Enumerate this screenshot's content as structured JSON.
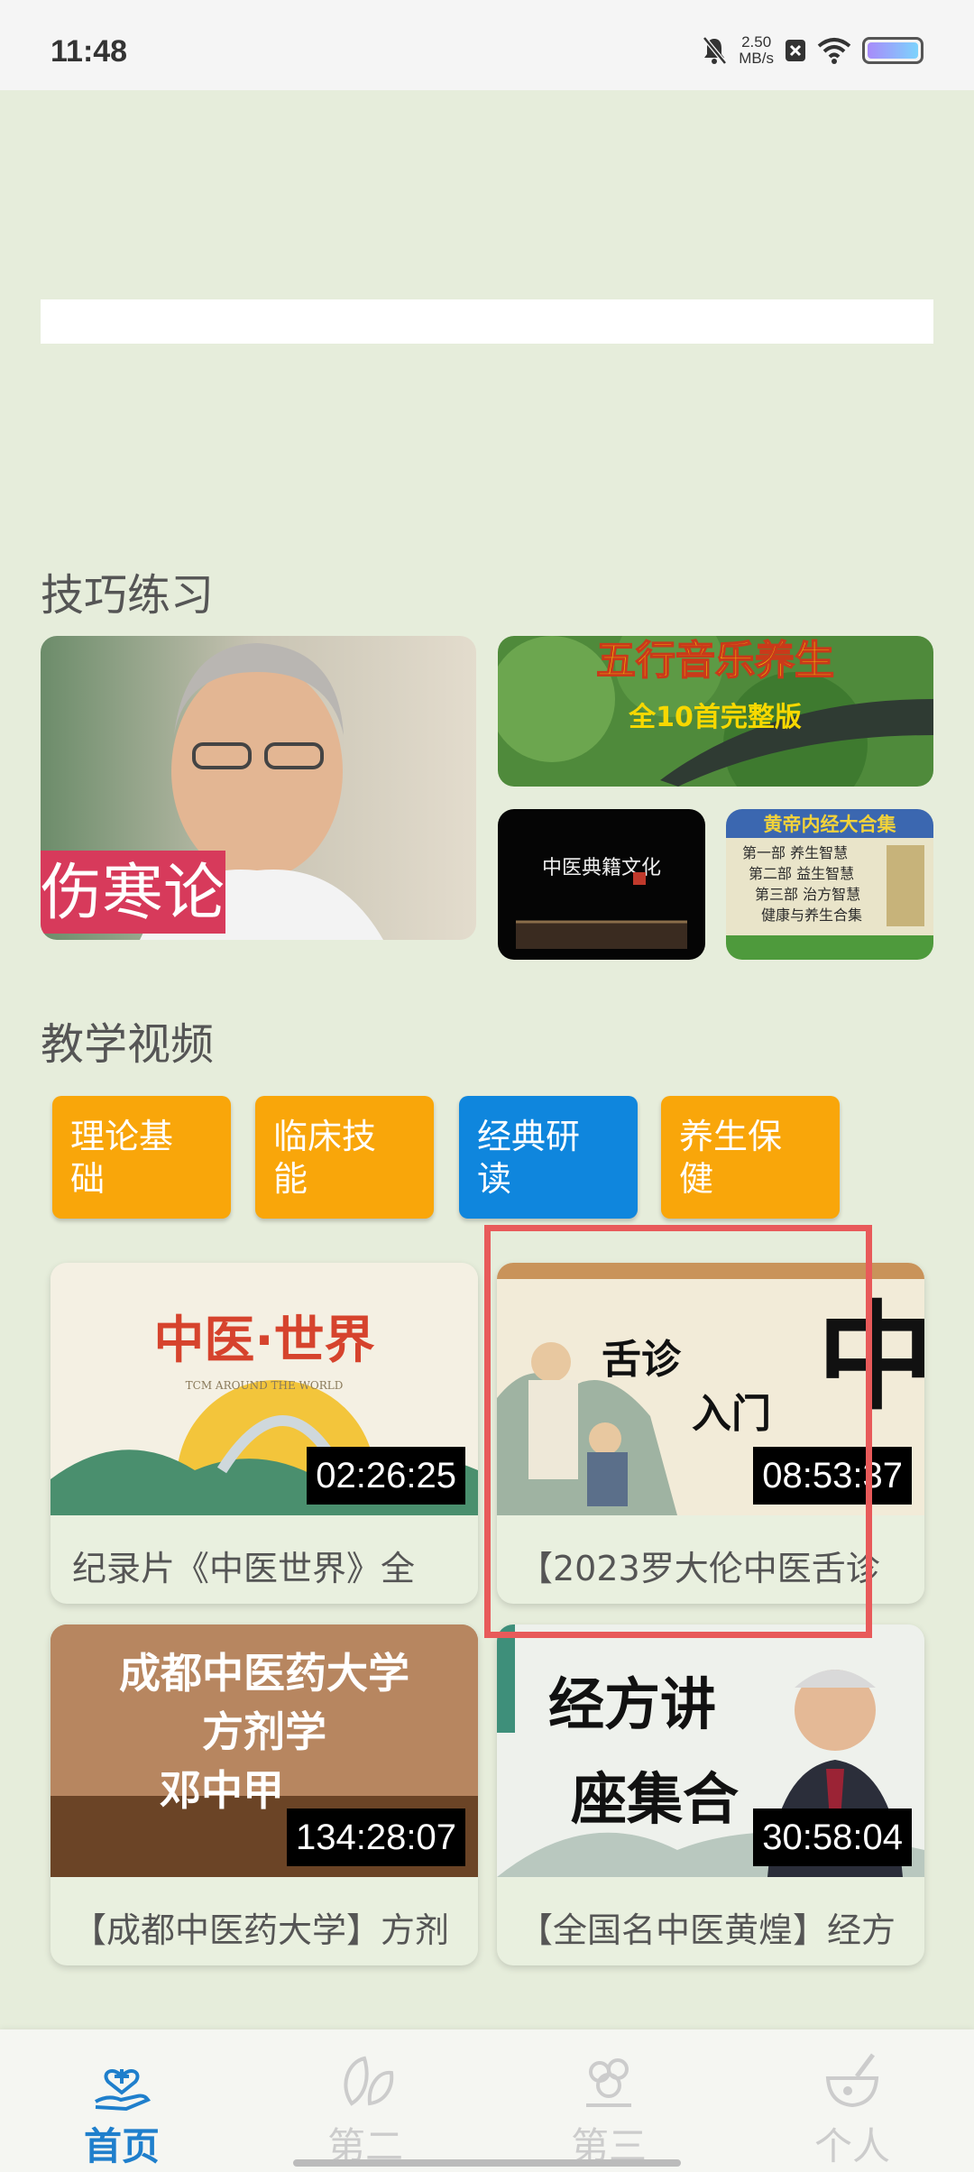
{
  "status_bar": {
    "time": "11:48",
    "net_speed_value": "2.50",
    "net_speed_unit": "MB/s"
  },
  "sections": {
    "skills_title": "技巧练习",
    "videos_title": "教学视频"
  },
  "featured": {
    "shanghan_text": "伤寒论",
    "wuxing_title": "五行音乐养生",
    "wuxing_subtitle": "全10首完整版",
    "culture_text": "中医典籍文化",
    "neijing_title": "黄帝内经大合集",
    "neijing_lines": [
      "第一部 养生智慧",
      "第二部 益生智慧",
      "第三部 治方智慧",
      "健康与养生合集"
    ]
  },
  "categories": [
    {
      "line1": "理论基",
      "line2": "础",
      "color": "orange"
    },
    {
      "line1": "临床技",
      "line2": "能",
      "color": "orange"
    },
    {
      "line1": "经典研",
      "line2": "读",
      "color": "blue"
    },
    {
      "line1": "养生保",
      "line2": "健",
      "color": "orange"
    }
  ],
  "videos": [
    {
      "title": "纪录片《中医世界》全",
      "duration": "02:26:25",
      "thumb_text": "中医·世界",
      "thumb_sub": "TCM AROUND THE WORLD"
    },
    {
      "title": "【2023罗大伦中医舌诊",
      "duration": "08:53:37",
      "thumb_text1": "舌诊",
      "thumb_text2": "入门",
      "thumb_big": "中"
    },
    {
      "title": "【成都中医药大学】方剂",
      "duration": "134:28:07",
      "thumb_line1": "成都中医药大学",
      "thumb_line2": "方剂学",
      "thumb_line3": "邓中甲"
    },
    {
      "title": "【全国名中医黄煌】经方",
      "duration": "30:58:04",
      "thumb_line1": "经方讲",
      "thumb_line2": "座集合"
    }
  ],
  "bottom_nav": [
    {
      "label": "首页",
      "active": true
    },
    {
      "label": "第二",
      "active": false
    },
    {
      "label": "第三",
      "active": false
    },
    {
      "label": "个人",
      "active": false
    }
  ],
  "colors": {
    "accent_blue": "#1f7fcc",
    "category_orange": "#f9a60a",
    "category_blue": "#0f86dd",
    "highlight_red": "#e85a5a",
    "background": "#e6eddb"
  }
}
